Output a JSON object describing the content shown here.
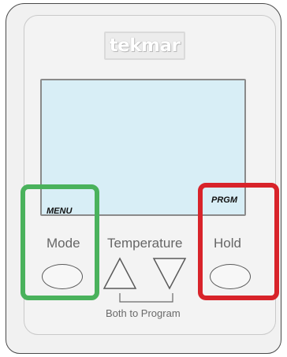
{
  "brand": {
    "logo_text": "tekmar"
  },
  "display": {
    "menu_label": "MENU",
    "prgm_label": "PRGM",
    "background_color": "#d8eef6"
  },
  "buttons": {
    "mode_label": "Mode",
    "temperature_label": "Temperature",
    "hold_label": "Hold",
    "both_to_program_label": "Both to Program",
    "up_icon": "triangle-up-icon",
    "down_icon": "triangle-down-icon"
  },
  "highlights": {
    "menu_mode_color": "#4ab25c",
    "prgm_hold_color": "#d8232a"
  }
}
